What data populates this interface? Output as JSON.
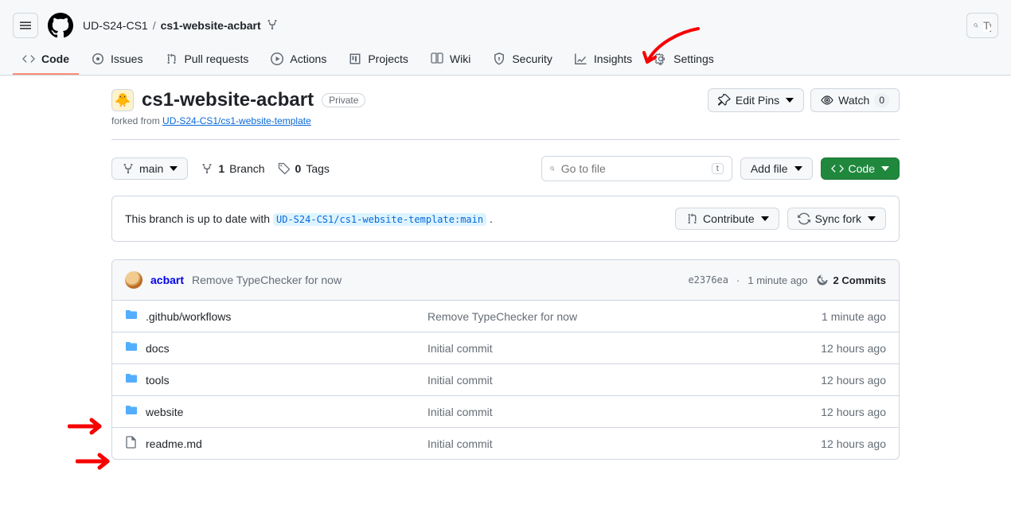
{
  "header": {
    "org": "UD-S24-CS1",
    "repo": "cs1-website-acbart",
    "search_placeholder": "Ty"
  },
  "tabs": {
    "code": "Code",
    "issues": "Issues",
    "pull_requests": "Pull requests",
    "actions": "Actions",
    "projects": "Projects",
    "wiki": "Wiki",
    "security": "Security",
    "insights": "Insights",
    "settings": "Settings"
  },
  "repo_header": {
    "name": "cs1-website-acbart",
    "visibility": "Private",
    "forked_prefix": "forked from ",
    "forked_from": "UD-S24-CS1/cs1-website-template",
    "edit_pins": "Edit Pins",
    "watch": "Watch",
    "watch_count": "0"
  },
  "branch_bar": {
    "branch_btn": "main",
    "branches_count": "1",
    "branches_label": "Branch",
    "tags_count": "0",
    "tags_label": "Tags",
    "search_placeholder": "Go to file",
    "search_kbd": "t",
    "add_file": "Add file",
    "code_btn": "Code"
  },
  "status": {
    "prefix": "This branch is up to date with",
    "ref": "UD-S24-CS1/cs1-website-template:main",
    "suffix": ".",
    "contribute": "Contribute",
    "sync": "Sync fork"
  },
  "commit_head": {
    "author": "acbart",
    "message": "Remove TypeChecker for now",
    "sha": "e2376ea",
    "sep": "·",
    "time": "1 minute ago",
    "commits_count": "2 Commits"
  },
  "files": [
    {
      "type": "dir",
      "name": ".github/workflows",
      "msg": "Remove TypeChecker for now",
      "time": "1 minute ago"
    },
    {
      "type": "dir",
      "name": "docs",
      "msg": "Initial commit",
      "time": "12 hours ago"
    },
    {
      "type": "dir",
      "name": "tools",
      "msg": "Initial commit",
      "time": "12 hours ago"
    },
    {
      "type": "dir",
      "name": "website",
      "msg": "Initial commit",
      "time": "12 hours ago"
    },
    {
      "type": "file",
      "name": "readme.md",
      "msg": "Initial commit",
      "time": "12 hours ago"
    }
  ]
}
